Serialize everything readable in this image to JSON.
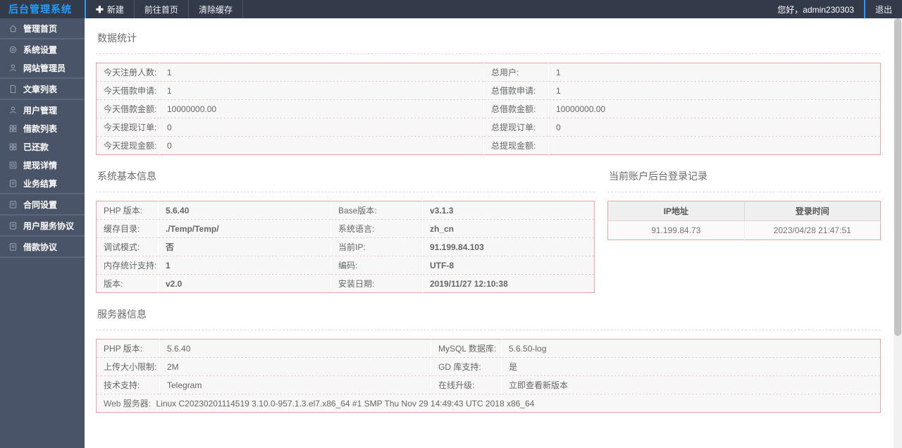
{
  "colors": {
    "accent": "#1E9FFF",
    "topbar_bg": "#333B4A",
    "sidebar_bg": "#4A5468",
    "table_border": "#F0A3A3",
    "cell_bg": "#F7F7F7",
    "header_cell_bg": "#EFEFEF"
  },
  "topbar": {
    "brand": "后台管理系统",
    "new_label": "新建",
    "home_label": "前往首页",
    "clear_cache_label": "清除缓存",
    "greeting": "您好，admin230303",
    "logout_label": "退出"
  },
  "sidebar": {
    "groups": [
      [
        {
          "icon": "home",
          "label": "管理首页"
        }
      ],
      [
        {
          "icon": "gear",
          "label": "系统设置"
        },
        {
          "icon": "user",
          "label": "网站管理员"
        }
      ],
      [
        {
          "icon": "file",
          "label": "文章列表"
        }
      ],
      [
        {
          "icon": "user",
          "label": "用户管理"
        },
        {
          "icon": "grid",
          "label": "借款列表"
        },
        {
          "icon": "grid",
          "label": "已还款"
        },
        {
          "icon": "square",
          "label": "提现详情"
        },
        {
          "icon": "doc",
          "label": "业务结算"
        }
      ],
      [
        {
          "icon": "doc",
          "label": "合同设置"
        }
      ],
      [
        {
          "icon": "doc",
          "label": "用户服务协议"
        }
      ],
      [
        {
          "icon": "doc",
          "label": "借款协议"
        }
      ]
    ]
  },
  "stats": {
    "title": "数据统计",
    "rows": [
      [
        "今天注册人数:",
        "1",
        "总用户:",
        "1"
      ],
      [
        "今天借款申请:",
        "1",
        "总借款申请:",
        "1"
      ],
      [
        "今天借款金额:",
        "10000000.00",
        "总借款金额:",
        "10000000.00"
      ],
      [
        "今天提现订单:",
        "0",
        "总提现订单:",
        "0"
      ],
      [
        "今天提现金额:",
        "0",
        "总提现金额:",
        ""
      ]
    ]
  },
  "system_info": {
    "title": "系统基本信息",
    "rows": [
      [
        "PHP 版本:",
        "5.6.40",
        "Base版本:",
        "v3.1.3"
      ],
      [
        "缓存目录:",
        "./Temp/Temp/",
        "系统语言:",
        "zh_cn"
      ],
      [
        "调试模式:",
        "否",
        "当前IP:",
        "91.199.84.103"
      ],
      [
        "内存统计支持:",
        "1",
        "编码:",
        "UTF-8"
      ],
      [
        "版本:",
        "v2.0",
        "安装日期:",
        "2019/11/27 12:10:38"
      ]
    ]
  },
  "login_records": {
    "title": "当前账户后台登录记录",
    "headers": [
      "IP地址",
      "登录时间"
    ],
    "rows": [
      [
        "91.199.84.73",
        "2023/04/28 21:47:51"
      ]
    ]
  },
  "server_info": {
    "title": "服务器信息",
    "rows": [
      [
        "PHP 版本:",
        "5.6.40",
        "MySQL 数据库:",
        "5.6.50-log"
      ],
      [
        "上传大小限制:",
        "2M",
        "GD 库支持:",
        "是"
      ],
      [
        "技术支持:",
        "Telegram",
        "在线升级:",
        "立即查看新版本"
      ]
    ],
    "web_server_label": "Web 服务器:",
    "web_server_value": "Linux C20230201114519 3.10.0-957.1.3.el7.x86_64 #1 SMP Thu Nov 29 14:49:43 UTC 2018 x86_64"
  }
}
